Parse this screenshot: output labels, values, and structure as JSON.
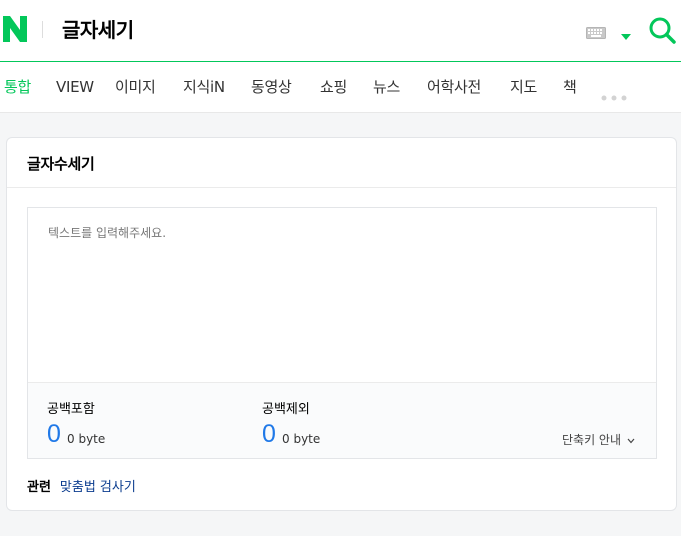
{
  "header": {
    "logo_text": "N",
    "query": "글자세기",
    "icons": {
      "keyboard": "keyboard-icon",
      "dropdown": "caret-down-icon",
      "search": "search-icon"
    },
    "accent_color": "#03c75a"
  },
  "tabs": {
    "items": [
      {
        "label": "통합",
        "active": true
      },
      {
        "label": "VIEW",
        "active": false
      },
      {
        "label": "이미지",
        "active": false
      },
      {
        "label": "지식iN",
        "active": false
      },
      {
        "label": "동영상",
        "active": false
      },
      {
        "label": "쇼핑",
        "active": false
      },
      {
        "label": "뉴스",
        "active": false
      },
      {
        "label": "어학사전",
        "active": false
      },
      {
        "label": "지도",
        "active": false
      },
      {
        "label": "책",
        "active": false
      }
    ],
    "more_icon": "more-dots-icon"
  },
  "counter": {
    "title": "글자수세기",
    "textarea": {
      "value": "",
      "placeholder": "텍스트를 입력해주세요."
    },
    "with_spaces": {
      "label": "공백포함",
      "count": "0",
      "bytes": "0 byte"
    },
    "without_spaces": {
      "label": "공백제외",
      "count": "0",
      "bytes": "0 byte"
    },
    "shortcut_label": "단축키 안내",
    "count_color": "#2079e8"
  },
  "related": {
    "label": "관련",
    "link": "맞춤법 검사기"
  }
}
